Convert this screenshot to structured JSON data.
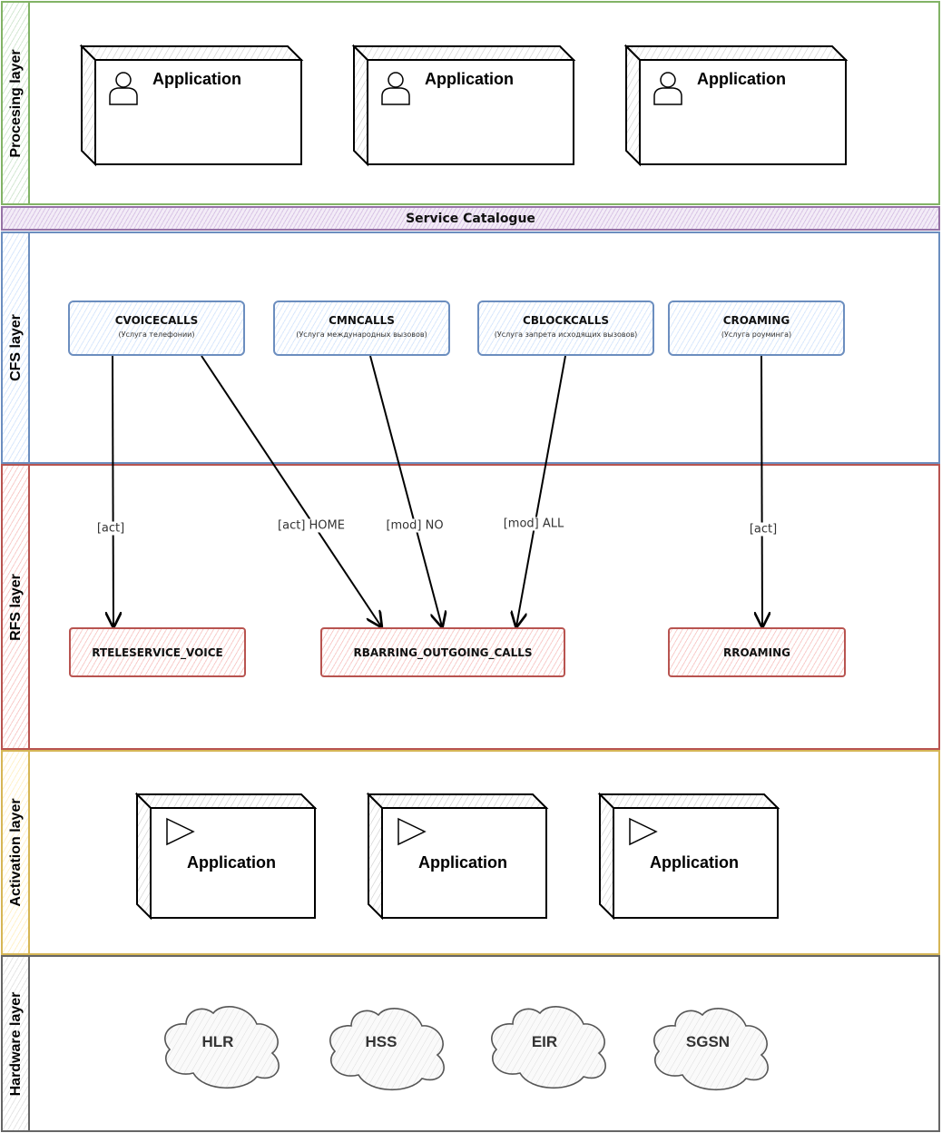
{
  "lanes": {
    "processing": {
      "title": "Procesing layer"
    },
    "service_catalogue": {
      "title": "Service Catalogue"
    },
    "cfs": {
      "title": "CFS layer"
    },
    "rfs": {
      "title": "RFS layer"
    },
    "activation": {
      "title": "Activation layer"
    },
    "hardware": {
      "title": "Hardware layer"
    }
  },
  "processing_nodes": [
    {
      "label": "Application",
      "icon": "user-icon"
    },
    {
      "label": "Application",
      "icon": "user-icon"
    },
    {
      "label": "Application",
      "icon": "user-icon"
    }
  ],
  "cfs_services": [
    {
      "name": "CVOICECALLS",
      "desc": "(Услуга телефонии)"
    },
    {
      "name": "CMNCALLS",
      "desc": "(Услуга международных вызовов)"
    },
    {
      "name": "CBLOCKCALLS",
      "desc": "(Услуга запрета исходящих вызовов)"
    },
    {
      "name": "CROAMING",
      "desc": "(Услуга роуминга)"
    }
  ],
  "rfs_services": [
    {
      "name": "RTELESERVICE_VOICE"
    },
    {
      "name": "RBARRING_OUTGOING_CALLS"
    },
    {
      "name": "RROAMING"
    }
  ],
  "edges": [
    {
      "from": "CVOICECALLS",
      "to": "RTELESERVICE_VOICE",
      "label": "[act]"
    },
    {
      "from": "CVOICECALLS",
      "to": "RBARRING_OUTGOING_CALLS",
      "label": "[act] HOME"
    },
    {
      "from": "CMNCALLS",
      "to": "RBARRING_OUTGOING_CALLS",
      "label": "[mod] NO"
    },
    {
      "from": "CBLOCKCALLS",
      "to": "RBARRING_OUTGOING_CALLS",
      "label": "[mod] ALL"
    },
    {
      "from": "CROAMING",
      "to": "RROAMING",
      "label": "[act]"
    }
  ],
  "activation_nodes": [
    {
      "label": "Application",
      "icon": "play-triangle-icon"
    },
    {
      "label": "Application",
      "icon": "play-triangle-icon"
    },
    {
      "label": "Application",
      "icon": "play-triangle-icon"
    }
  ],
  "hardware_nodes": [
    {
      "label": "HLR"
    },
    {
      "label": "HSS"
    },
    {
      "label": "EIR"
    },
    {
      "label": "SGSN"
    }
  ],
  "colors": {
    "processing": "#82b366",
    "service_catalogue": "#9673a6",
    "cfs": "#6c8ebf",
    "rfs": "#b85450",
    "activation": "#d6b656",
    "hardware": "#666666"
  }
}
